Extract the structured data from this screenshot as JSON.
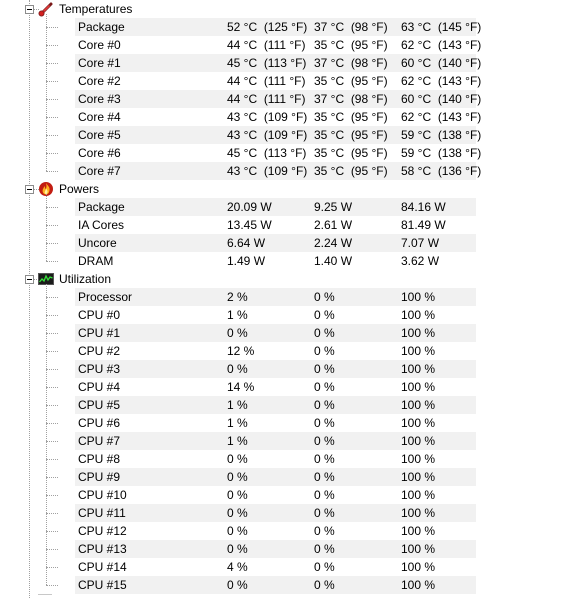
{
  "groups": [
    {
      "label": "Temperatures",
      "icon": "thermometer-icon",
      "rows": [
        {
          "name": "Package",
          "value": "52 °C  (125 °F)",
          "min": "37 °C  (98 °F)",
          "max": "63 °C  (145 °F)"
        },
        {
          "name": "Core #0",
          "value": "44 °C  (111 °F)",
          "min": "35 °C  (95 °F)",
          "max": "62 °C  (143 °F)"
        },
        {
          "name": "Core #1",
          "value": "45 °C  (113 °F)",
          "min": "37 °C  (98 °F)",
          "max": "60 °C  (140 °F)"
        },
        {
          "name": "Core #2",
          "value": "44 °C  (111 °F)",
          "min": "35 °C  (95 °F)",
          "max": "62 °C  (143 °F)"
        },
        {
          "name": "Core #3",
          "value": "44 °C  (111 °F)",
          "min": "37 °C  (98 °F)",
          "max": "60 °C  (140 °F)"
        },
        {
          "name": "Core #4",
          "value": "43 °C  (109 °F)",
          "min": "35 °C  (95 °F)",
          "max": "62 °C  (143 °F)"
        },
        {
          "name": "Core #5",
          "value": "43 °C  (109 °F)",
          "min": "35 °C  (95 °F)",
          "max": "59 °C  (138 °F)"
        },
        {
          "name": "Core #6",
          "value": "45 °C  (113 °F)",
          "min": "35 °C  (95 °F)",
          "max": "59 °C  (138 °F)"
        },
        {
          "name": "Core #7",
          "value": "43 °C  (109 °F)",
          "min": "35 °C  (95 °F)",
          "max": "58 °C  (136 °F)"
        }
      ]
    },
    {
      "label": "Powers",
      "icon": "flame-icon",
      "rows": [
        {
          "name": "Package",
          "value": "20.09 W",
          "min": "9.25 W",
          "max": "84.16 W"
        },
        {
          "name": "IA Cores",
          "value": "13.45 W",
          "min": "2.61 W",
          "max": "81.49 W"
        },
        {
          "name": "Uncore",
          "value": "6.64 W",
          "min": "2.24 W",
          "max": "7.07 W"
        },
        {
          "name": "DRAM",
          "value": "1.49 W",
          "min": "1.40 W",
          "max": "3.62 W"
        }
      ]
    },
    {
      "label": "Utilization",
      "icon": "monitor-graph-icon",
      "rows": [
        {
          "name": "Processor",
          "value": "2 %",
          "min": "0 %",
          "max": "100 %"
        },
        {
          "name": "CPU #0",
          "value": "1 %",
          "min": "0 %",
          "max": "100 %"
        },
        {
          "name": "CPU #1",
          "value": "0 %",
          "min": "0 %",
          "max": "100 %"
        },
        {
          "name": "CPU #2",
          "value": "12 %",
          "min": "0 %",
          "max": "100 %"
        },
        {
          "name": "CPU #3",
          "value": "0 %",
          "min": "0 %",
          "max": "100 %"
        },
        {
          "name": "CPU #4",
          "value": "14 %",
          "min": "0 %",
          "max": "100 %"
        },
        {
          "name": "CPU #5",
          "value": "1 %",
          "min": "0 %",
          "max": "100 %"
        },
        {
          "name": "CPU #6",
          "value": "1 %",
          "min": "0 %",
          "max": "100 %"
        },
        {
          "name": "CPU #7",
          "value": "1 %",
          "min": "0 %",
          "max": "100 %"
        },
        {
          "name": "CPU #8",
          "value": "0 %",
          "min": "0 %",
          "max": "100 %"
        },
        {
          "name": "CPU #9",
          "value": "0 %",
          "min": "0 %",
          "max": "100 %"
        },
        {
          "name": "CPU #10",
          "value": "0 %",
          "min": "0 %",
          "max": "100 %"
        },
        {
          "name": "CPU #11",
          "value": "0 %",
          "min": "0 %",
          "max": "100 %"
        },
        {
          "name": "CPU #12",
          "value": "0 %",
          "min": "0 %",
          "max": "100 %"
        },
        {
          "name": "CPU #13",
          "value": "0 %",
          "min": "0 %",
          "max": "100 %"
        },
        {
          "name": "CPU #14",
          "value": "4 %",
          "min": "0 %",
          "max": "100 %"
        },
        {
          "name": "CPU #15",
          "value": "0 %",
          "min": "0 %",
          "max": "100 %"
        }
      ]
    }
  ]
}
